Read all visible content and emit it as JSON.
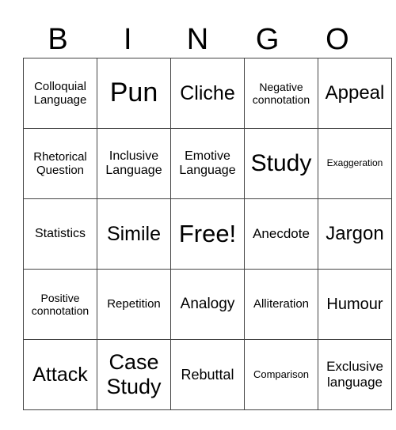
{
  "header": [
    "B",
    "I",
    "N",
    "G",
    "O"
  ],
  "rows": [
    [
      "Colloquial Language",
      "Pun",
      "Cliche",
      "Negative connotation",
      "Appeal"
    ],
    [
      "Rhetorical Question",
      "Inclusive Language",
      "Emotive Language",
      "Study",
      "Exaggeration"
    ],
    [
      "Statistics",
      "Simile",
      "Free!",
      "Anecdote",
      "Jargon"
    ],
    [
      "Positive connotation",
      "Repetition",
      "Analogy",
      "Alliteration",
      "Humour"
    ],
    [
      "Attack",
      "Case Study",
      "Rebuttal",
      "Comparison",
      "Exclusive language"
    ]
  ]
}
